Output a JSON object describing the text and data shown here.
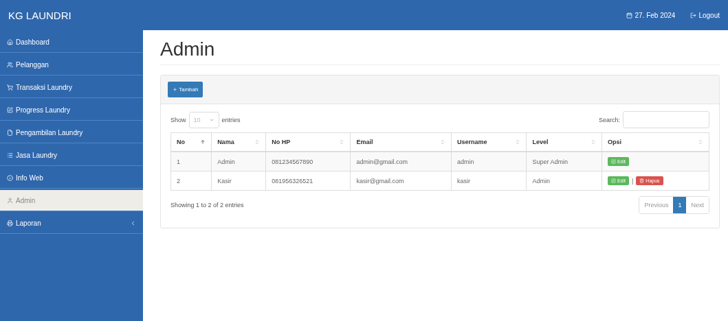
{
  "brand": "KG LAUNDRI",
  "topbar": {
    "date": "27. Feb 2024",
    "logout": "Logout"
  },
  "sidebar": {
    "items": [
      {
        "kind": "dashboard",
        "label": "Dashboard",
        "selected": false,
        "submenu": false
      },
      {
        "kind": "users",
        "label": "Pelanggan",
        "selected": false,
        "submenu": false
      },
      {
        "kind": "cart",
        "label": "Transaksi Laundry",
        "selected": false,
        "submenu": false
      },
      {
        "kind": "progress",
        "label": "Progress Laundry",
        "selected": false,
        "submenu": false
      },
      {
        "kind": "file",
        "label": "Pengambilan Laundry",
        "selected": false,
        "submenu": false
      },
      {
        "kind": "list",
        "label": "Jasa Laundry",
        "selected": false,
        "submenu": false
      },
      {
        "kind": "info",
        "label": "Info Web",
        "selected": false,
        "submenu": false
      },
      {
        "kind": "user",
        "label": "Admin",
        "selected": true,
        "submenu": false
      },
      {
        "kind": "print",
        "label": "Laporan",
        "selected": false,
        "submenu": true
      }
    ]
  },
  "page_title": "Admin",
  "add_button": "Tambah",
  "length": {
    "show": "Show",
    "value": "10",
    "entries": "entries"
  },
  "search": {
    "label": "Search:"
  },
  "table": {
    "columns": [
      {
        "label": "No",
        "sorted": true
      },
      {
        "label": "Nama",
        "sorted": false
      },
      {
        "label": "No HP",
        "sorted": false
      },
      {
        "label": "Email",
        "sorted": false
      },
      {
        "label": "Username",
        "sorted": false
      },
      {
        "label": "Level",
        "sorted": false
      },
      {
        "label": "Opsi",
        "sorted": false
      }
    ],
    "action_separator": "|",
    "rows": [
      {
        "cells": [
          "1",
          "Admin",
          "081234567890",
          "admin@gmail.com",
          "admin",
          "Super Admin"
        ],
        "actions": [
          {
            "kind": "edit",
            "label": "Edit"
          }
        ]
      },
      {
        "cells": [
          "2",
          "Kasir",
          "081956326521",
          "kasir@gmail.com",
          "kasir",
          "Admin"
        ],
        "actions": [
          {
            "kind": "edit",
            "label": "Edit"
          },
          {
            "kind": "delete",
            "label": "Hapus"
          }
        ]
      }
    ]
  },
  "info": "Showing 1 to 2 of 2 entries",
  "pagination": [
    {
      "label": "Previous",
      "selected": false
    },
    {
      "label": "1",
      "selected": true
    },
    {
      "label": "Next",
      "selected": false
    }
  ]
}
